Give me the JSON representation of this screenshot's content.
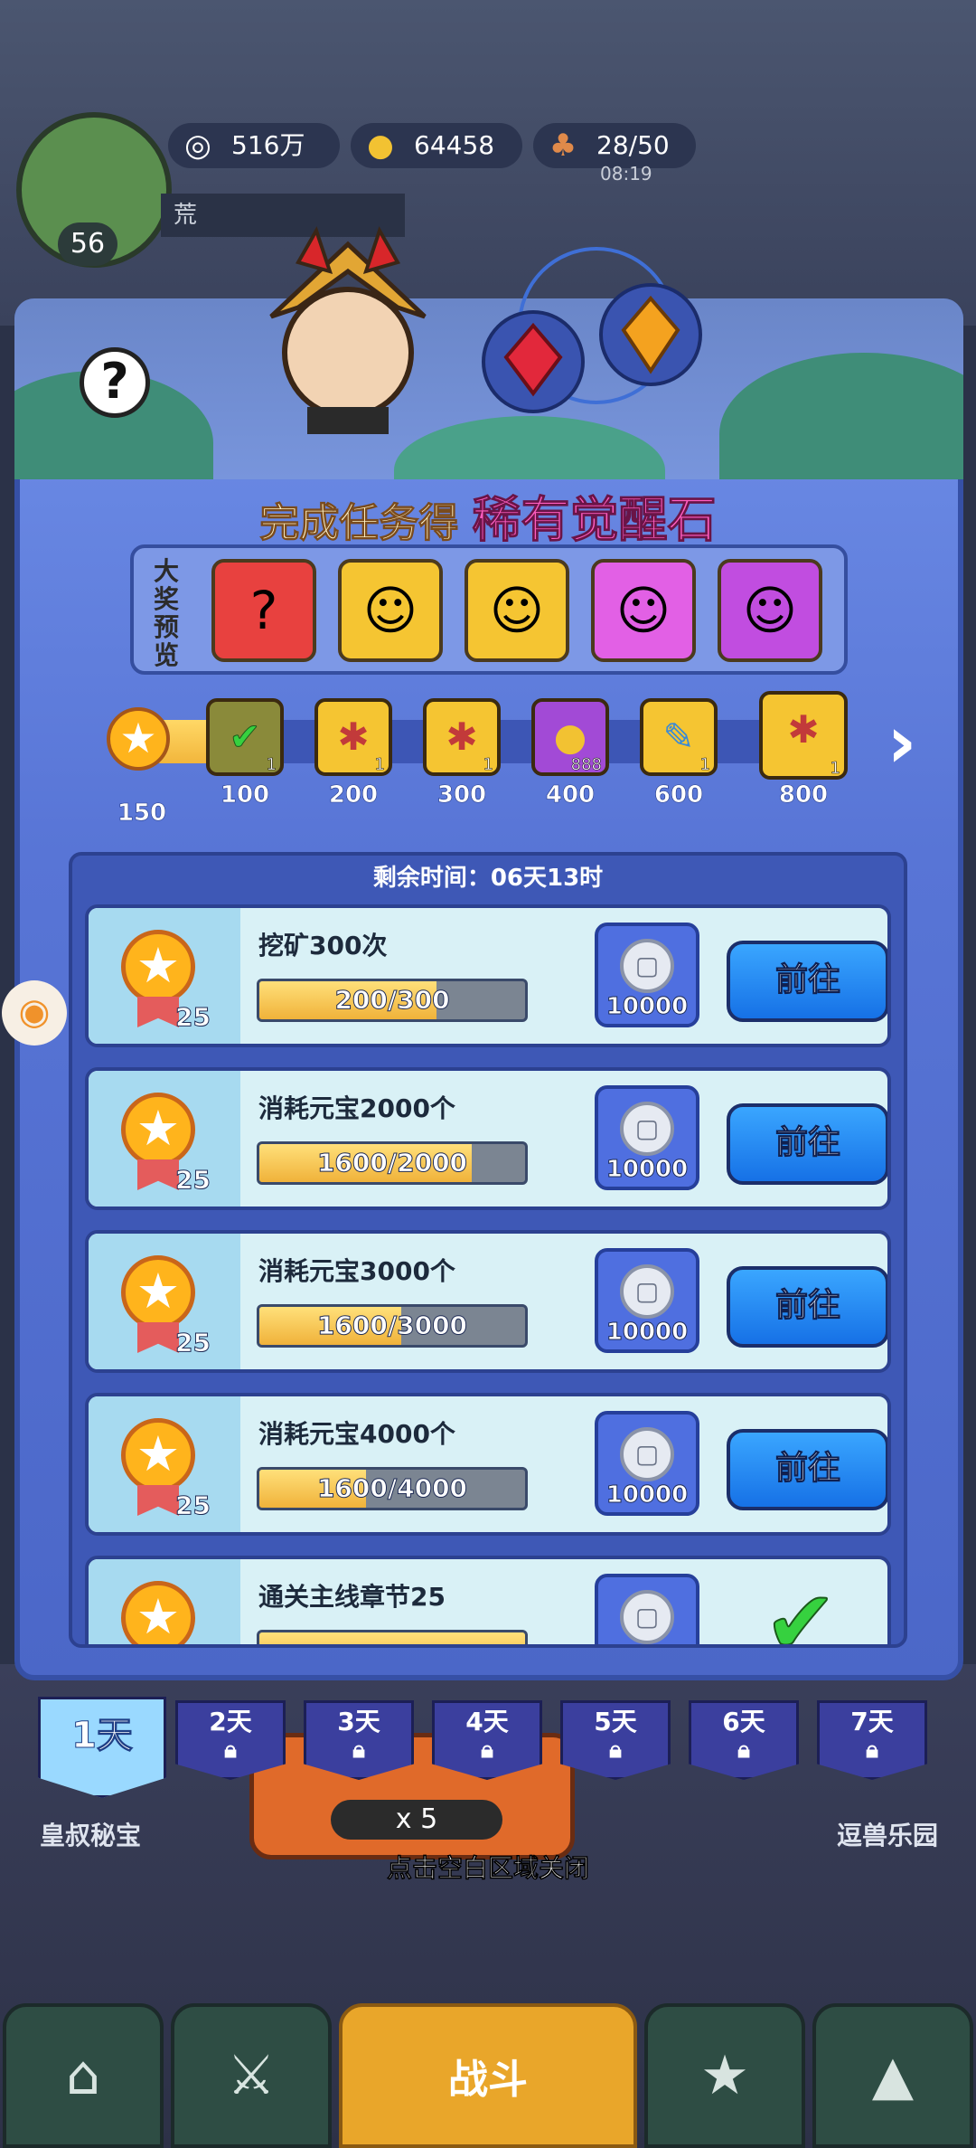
{
  "hud": {
    "level": "56",
    "player_name": "荒",
    "resources": [
      {
        "icon": "silver-coin-icon",
        "value": "516万"
      },
      {
        "icon": "gold-ingot-icon",
        "value": "64458"
      },
      {
        "icon": "meat-icon",
        "value": "28/50"
      }
    ],
    "stamina_timer": "08:19"
  },
  "modal": {
    "title_prefix": "完成任务得",
    "title_highlight": "稀有觉醒石",
    "help_label": "?",
    "preview_label": "大奖预览",
    "preview_items": [
      {
        "icon": "mystery-puzzle-icon",
        "color": "#e8413f"
      },
      {
        "icon": "hero-portrait-icon",
        "color": "#f5c532"
      },
      {
        "icon": "hero-portrait-icon",
        "color": "#f5c532"
      },
      {
        "icon": "hero-portrait-icon",
        "color": "#e260e5"
      },
      {
        "icon": "hero-portrait-icon",
        "color": "#c14de0"
      }
    ],
    "current_score": "150",
    "milestones": [
      {
        "label": "100",
        "icon": "check-icon",
        "count": "1",
        "claimed": true,
        "color": "#8a8a3a"
      },
      {
        "label": "200",
        "icon": "puzzle-fragment-icon",
        "count": "1",
        "claimed": false,
        "color": "#f5c532"
      },
      {
        "label": "300",
        "icon": "puzzle-fragment-icon",
        "count": "1",
        "claimed": false,
        "color": "#f5c532"
      },
      {
        "label": "400",
        "icon": "gold-ingot-icon",
        "count": "888",
        "claimed": false,
        "color": "#a24ad6"
      },
      {
        "label": "600",
        "icon": "scroll-icon",
        "count": "1",
        "claimed": false,
        "color": "#f5c532"
      },
      {
        "label": "800",
        "icon": "puzzle-fragment-icon",
        "count": "1",
        "claimed": false,
        "color": "#f5c532"
      }
    ],
    "remaining_time": "剩余时间：06天13时",
    "tasks": [
      {
        "name": "挖矿300次",
        "progress_text": "200/300",
        "progress": 0.667,
        "medal_count": "25",
        "reward": "10000",
        "action": "前往",
        "completed": false
      },
      {
        "name": "消耗元宝2000个",
        "progress_text": "1600/2000",
        "progress": 0.8,
        "medal_count": "25",
        "reward": "10000",
        "action": "前往",
        "completed": false
      },
      {
        "name": "消耗元宝3000个",
        "progress_text": "1600/3000",
        "progress": 0.533,
        "medal_count": "25",
        "reward": "10000",
        "action": "前往",
        "completed": false
      },
      {
        "name": "消耗元宝4000个",
        "progress_text": "1600/4000",
        "progress": 0.4,
        "medal_count": "25",
        "reward": "10000",
        "action": "前往",
        "completed": false
      },
      {
        "name": "通关主线章节25",
        "progress_text": "",
        "progress": 1.0,
        "medal_count": "25",
        "reward": "10000",
        "action": "",
        "completed": true
      }
    ]
  },
  "days": [
    {
      "label": "1天",
      "active": true,
      "locked": false
    },
    {
      "label": "2天",
      "active": false,
      "locked": true
    },
    {
      "label": "3天",
      "active": false,
      "locked": true
    },
    {
      "label": "4天",
      "active": false,
      "locked": true
    },
    {
      "label": "5天",
      "active": false,
      "locked": true
    },
    {
      "label": "6天",
      "active": false,
      "locked": true
    },
    {
      "label": "7天",
      "active": false,
      "locked": true
    }
  ],
  "background": {
    "left_label": "皇叔秘宝",
    "right_label": "逗兽乐园",
    "battle_cost": "x 5",
    "battle_label": "战斗"
  },
  "close_hint": "点击空白区域关闭",
  "colors": {
    "accent_blue": "#5875d6",
    "go_button": "#1671e6",
    "progress_fill": "#f0b23a"
  }
}
